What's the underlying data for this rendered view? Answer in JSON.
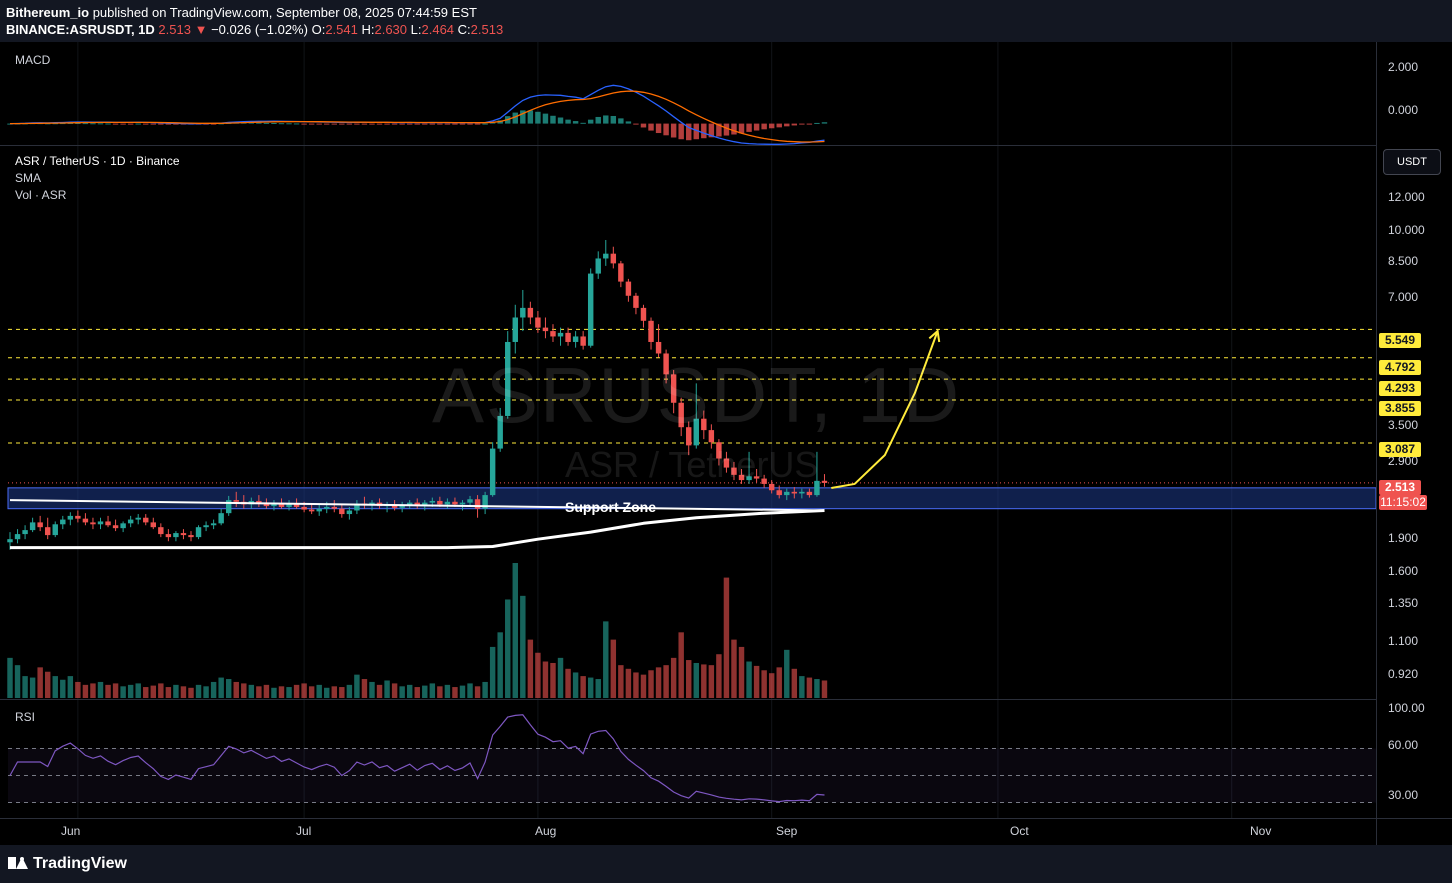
{
  "header": {
    "author": "Bithereum_io",
    "published_text": " published on TradingView.com, September 08, 2025 07:44:59 EST",
    "symbol_line": "BINANCE:ASRUSDT, 1D",
    "last": "2.513",
    "change_arrow": "▼",
    "change": "−0.026 (−1.02%)",
    "o_label": "O:",
    "o_value": "2.541",
    "h_label": "H:",
    "h_value": "2.630",
    "l_label": "L:",
    "l_value": "2.464",
    "c_label": "C:",
    "c_value": "2.513"
  },
  "macd_pane": {
    "label": "MACD",
    "ticks": [
      "2.000",
      "0.000"
    ]
  },
  "price_pane": {
    "title": "ASR / TetherUS · 1D · Binance",
    "sma_label": "SMA",
    "vol_label": "Vol · ASR",
    "currency_button": "USDT",
    "watermark": "ASRUSDT, 1D",
    "watermark_sub": "ASR / TetherUS",
    "support_label": "Support Zone",
    "ticks": [
      "12.000",
      "10.000",
      "8.500",
      "7.000",
      "3.500",
      "2.900",
      "1.900",
      "1.600",
      "1.350",
      "1.100",
      "0.920"
    ],
    "level_badges": [
      "5.549",
      "4.792",
      "4.293",
      "3.855",
      "3.087"
    ],
    "current_price": "2.513",
    "countdown": "11:15:02"
  },
  "rsi_pane": {
    "label": "RSI",
    "ticks": [
      "100.00",
      "60.00",
      "30.00"
    ]
  },
  "x_axis": {
    "labels": [
      "Jun",
      "Jul",
      "Aug",
      "Sep",
      "Oct",
      "Nov"
    ]
  },
  "footer": {
    "brand": "TradingView"
  },
  "colors": {
    "bull": "#26a69a",
    "bear": "#ef5350",
    "level": "#ffeb3b",
    "sma": "#ffffff",
    "macd": "#2962ff",
    "signal": "#ff6d00",
    "rsi": "#7e57c2",
    "zone": "#1e3a8a"
  },
  "chart_data": {
    "type": "candlestick",
    "symbol": "ASRUSDT",
    "interval": "1D",
    "y_scale": "log",
    "ylim": [
      0.82,
      14.0
    ],
    "x_start_date": "2025-05-23",
    "x_end_date": "2025-11-20",
    "support_zone": [
      2.2,
      2.45
    ],
    "resistance_levels": [
      5.549,
      4.792,
      4.293,
      3.855,
      3.087
    ],
    "ohlc": [
      {
        "date": "2025-05-23",
        "o": 1.85,
        "h": 1.95,
        "l": 1.78,
        "c": 1.88
      },
      {
        "date": "2025-05-24",
        "o": 1.88,
        "h": 1.98,
        "l": 1.84,
        "c": 1.93
      },
      {
        "date": "2025-05-25",
        "o": 1.93,
        "h": 2.02,
        "l": 1.88,
        "c": 1.97
      },
      {
        "date": "2025-05-26",
        "o": 1.97,
        "h": 2.1,
        "l": 1.95,
        "c": 2.05
      },
      {
        "date": "2025-05-27",
        "o": 2.05,
        "h": 2.12,
        "l": 1.96,
        "c": 2.0
      },
      {
        "date": "2025-05-28",
        "o": 2.0,
        "h": 2.1,
        "l": 1.88,
        "c": 1.92
      },
      {
        "date": "2025-05-29",
        "o": 1.92,
        "h": 2.06,
        "l": 1.9,
        "c": 2.03
      },
      {
        "date": "2025-05-30",
        "o": 2.03,
        "h": 2.12,
        "l": 1.98,
        "c": 2.08
      },
      {
        "date": "2025-05-31",
        "o": 2.08,
        "h": 2.16,
        "l": 2.02,
        "c": 2.12
      },
      {
        "date": "2025-06-01",
        "o": 2.12,
        "h": 2.18,
        "l": 2.05,
        "c": 2.09
      },
      {
        "date": "2025-06-02",
        "o": 2.09,
        "h": 2.15,
        "l": 2.02,
        "c": 2.05
      },
      {
        "date": "2025-06-03",
        "o": 2.05,
        "h": 2.1,
        "l": 1.98,
        "c": 2.03
      },
      {
        "date": "2025-06-04",
        "o": 2.03,
        "h": 2.1,
        "l": 1.98,
        "c": 2.06
      },
      {
        "date": "2025-06-05",
        "o": 2.06,
        "h": 2.12,
        "l": 2.0,
        "c": 2.02
      },
      {
        "date": "2025-06-06",
        "o": 2.02,
        "h": 2.08,
        "l": 1.96,
        "c": 1.99
      },
      {
        "date": "2025-06-07",
        "o": 1.99,
        "h": 2.06,
        "l": 1.95,
        "c": 2.04
      },
      {
        "date": "2025-06-08",
        "o": 2.04,
        "h": 2.12,
        "l": 2.0,
        "c": 2.08
      },
      {
        "date": "2025-06-09",
        "o": 2.08,
        "h": 2.14,
        "l": 2.03,
        "c": 2.1
      },
      {
        "date": "2025-06-10",
        "o": 2.1,
        "h": 2.14,
        "l": 2.02,
        "c": 2.05
      },
      {
        "date": "2025-06-11",
        "o": 2.05,
        "h": 2.1,
        "l": 1.98,
        "c": 2.0
      },
      {
        "date": "2025-06-12",
        "o": 2.0,
        "h": 2.04,
        "l": 1.9,
        "c": 1.93
      },
      {
        "date": "2025-06-13",
        "o": 1.93,
        "h": 1.98,
        "l": 1.86,
        "c": 1.9
      },
      {
        "date": "2025-06-14",
        "o": 1.9,
        "h": 1.96,
        "l": 1.86,
        "c": 1.94
      },
      {
        "date": "2025-06-15",
        "o": 1.94,
        "h": 1.98,
        "l": 1.88,
        "c": 1.92
      },
      {
        "date": "2025-06-16",
        "o": 1.92,
        "h": 1.96,
        "l": 1.86,
        "c": 1.9
      },
      {
        "date": "2025-06-17",
        "o": 1.9,
        "h": 2.02,
        "l": 1.88,
        "c": 2.0
      },
      {
        "date": "2025-06-18",
        "o": 2.0,
        "h": 2.06,
        "l": 1.96,
        "c": 2.02
      },
      {
        "date": "2025-06-19",
        "o": 2.02,
        "h": 2.08,
        "l": 1.98,
        "c": 2.04
      },
      {
        "date": "2025-06-20",
        "o": 2.04,
        "h": 2.2,
        "l": 2.02,
        "c": 2.15
      },
      {
        "date": "2025-06-21",
        "o": 2.15,
        "h": 2.35,
        "l": 2.12,
        "c": 2.3
      },
      {
        "date": "2025-06-22",
        "o": 2.3,
        "h": 2.4,
        "l": 2.22,
        "c": 2.28
      },
      {
        "date": "2025-06-23",
        "o": 2.28,
        "h": 2.36,
        "l": 2.2,
        "c": 2.25
      },
      {
        "date": "2025-06-24",
        "o": 2.25,
        "h": 2.33,
        "l": 2.2,
        "c": 2.29
      },
      {
        "date": "2025-06-25",
        "o": 2.29,
        "h": 2.36,
        "l": 2.22,
        "c": 2.26
      },
      {
        "date": "2025-06-26",
        "o": 2.26,
        "h": 2.32,
        "l": 2.2,
        "c": 2.23
      },
      {
        "date": "2025-06-27",
        "o": 2.23,
        "h": 2.3,
        "l": 2.18,
        "c": 2.26
      },
      {
        "date": "2025-06-28",
        "o": 2.26,
        "h": 2.32,
        "l": 2.2,
        "c": 2.22
      },
      {
        "date": "2025-06-29",
        "o": 2.22,
        "h": 2.3,
        "l": 2.18,
        "c": 2.25
      },
      {
        "date": "2025-06-30",
        "o": 2.25,
        "h": 2.32,
        "l": 2.2,
        "c": 2.22
      },
      {
        "date": "2025-07-01",
        "o": 2.22,
        "h": 2.28,
        "l": 2.16,
        "c": 2.19
      },
      {
        "date": "2025-07-02",
        "o": 2.19,
        "h": 2.26,
        "l": 2.14,
        "c": 2.17
      },
      {
        "date": "2025-07-03",
        "o": 2.17,
        "h": 2.26,
        "l": 2.12,
        "c": 2.2
      },
      {
        "date": "2025-07-04",
        "o": 2.2,
        "h": 2.28,
        "l": 2.15,
        "c": 2.22
      },
      {
        "date": "2025-07-05",
        "o": 2.22,
        "h": 2.3,
        "l": 2.16,
        "c": 2.2
      },
      {
        "date": "2025-07-06",
        "o": 2.2,
        "h": 2.26,
        "l": 2.1,
        "c": 2.14
      },
      {
        "date": "2025-07-07",
        "o": 2.14,
        "h": 2.22,
        "l": 2.08,
        "c": 2.18
      },
      {
        "date": "2025-07-08",
        "o": 2.18,
        "h": 2.3,
        "l": 2.14,
        "c": 2.26
      },
      {
        "date": "2025-07-09",
        "o": 2.26,
        "h": 2.34,
        "l": 2.2,
        "c": 2.24
      },
      {
        "date": "2025-07-10",
        "o": 2.24,
        "h": 2.3,
        "l": 2.18,
        "c": 2.27
      },
      {
        "date": "2025-07-11",
        "o": 2.27,
        "h": 2.32,
        "l": 2.2,
        "c": 2.23
      },
      {
        "date": "2025-07-12",
        "o": 2.23,
        "h": 2.28,
        "l": 2.16,
        "c": 2.25
      },
      {
        "date": "2025-07-13",
        "o": 2.25,
        "h": 2.3,
        "l": 2.18,
        "c": 2.21
      },
      {
        "date": "2025-07-14",
        "o": 2.21,
        "h": 2.28,
        "l": 2.16,
        "c": 2.24
      },
      {
        "date": "2025-07-15",
        "o": 2.24,
        "h": 2.3,
        "l": 2.2,
        "c": 2.27
      },
      {
        "date": "2025-07-16",
        "o": 2.27,
        "h": 2.32,
        "l": 2.2,
        "c": 2.23
      },
      {
        "date": "2025-07-17",
        "o": 2.23,
        "h": 2.3,
        "l": 2.18,
        "c": 2.27
      },
      {
        "date": "2025-07-18",
        "o": 2.27,
        "h": 2.33,
        "l": 2.22,
        "c": 2.29
      },
      {
        "date": "2025-07-19",
        "o": 2.29,
        "h": 2.34,
        "l": 2.22,
        "c": 2.25
      },
      {
        "date": "2025-07-20",
        "o": 2.25,
        "h": 2.32,
        "l": 2.2,
        "c": 2.28
      },
      {
        "date": "2025-07-21",
        "o": 2.28,
        "h": 2.33,
        "l": 2.22,
        "c": 2.25
      },
      {
        "date": "2025-07-22",
        "o": 2.25,
        "h": 2.3,
        "l": 2.18,
        "c": 2.27
      },
      {
        "date": "2025-07-23",
        "o": 2.27,
        "h": 2.35,
        "l": 2.22,
        "c": 2.31
      },
      {
        "date": "2025-07-24",
        "o": 2.31,
        "h": 2.36,
        "l": 2.1,
        "c": 2.2
      },
      {
        "date": "2025-07-25",
        "o": 2.2,
        "h": 2.4,
        "l": 2.14,
        "c": 2.36
      },
      {
        "date": "2025-07-26",
        "o": 2.36,
        "h": 3.1,
        "l": 2.34,
        "c": 3.0
      },
      {
        "date": "2025-07-27",
        "o": 3.0,
        "h": 3.7,
        "l": 2.95,
        "c": 3.55
      },
      {
        "date": "2025-07-28",
        "o": 3.55,
        "h": 5.5,
        "l": 3.5,
        "c": 5.2
      },
      {
        "date": "2025-07-29",
        "o": 5.2,
        "h": 6.3,
        "l": 4.9,
        "c": 5.9
      },
      {
        "date": "2025-07-30",
        "o": 5.9,
        "h": 6.8,
        "l": 5.5,
        "c": 6.2
      },
      {
        "date": "2025-07-31",
        "o": 6.2,
        "h": 6.4,
        "l": 5.7,
        "c": 5.9
      },
      {
        "date": "2025-08-01",
        "o": 5.9,
        "h": 6.1,
        "l": 5.45,
        "c": 5.6
      },
      {
        "date": "2025-08-02",
        "o": 5.6,
        "h": 5.9,
        "l": 5.3,
        "c": 5.5
      },
      {
        "date": "2025-08-03",
        "o": 5.5,
        "h": 5.7,
        "l": 5.2,
        "c": 5.35
      },
      {
        "date": "2025-08-04",
        "o": 5.35,
        "h": 5.6,
        "l": 5.1,
        "c": 5.45
      },
      {
        "date": "2025-08-05",
        "o": 5.45,
        "h": 5.6,
        "l": 5.1,
        "c": 5.2
      },
      {
        "date": "2025-08-06",
        "o": 5.2,
        "h": 5.5,
        "l": 5.05,
        "c": 5.35
      },
      {
        "date": "2025-08-07",
        "o": 5.35,
        "h": 5.5,
        "l": 5.0,
        "c": 5.1
      },
      {
        "date": "2025-08-08",
        "o": 5.1,
        "h": 7.6,
        "l": 5.05,
        "c": 7.4
      },
      {
        "date": "2025-08-09",
        "o": 7.4,
        "h": 8.3,
        "l": 7.2,
        "c": 8.0
      },
      {
        "date": "2025-08-10",
        "o": 8.0,
        "h": 8.8,
        "l": 7.7,
        "c": 8.2
      },
      {
        "date": "2025-08-11",
        "o": 8.2,
        "h": 8.5,
        "l": 7.6,
        "c": 7.8
      },
      {
        "date": "2025-08-12",
        "o": 7.8,
        "h": 7.9,
        "l": 6.9,
        "c": 7.1
      },
      {
        "date": "2025-08-13",
        "o": 7.1,
        "h": 7.2,
        "l": 6.4,
        "c": 6.6
      },
      {
        "date": "2025-08-14",
        "o": 6.6,
        "h": 6.7,
        "l": 6.0,
        "c": 6.2
      },
      {
        "date": "2025-08-15",
        "o": 6.2,
        "h": 6.3,
        "l": 5.6,
        "c": 5.8
      },
      {
        "date": "2025-08-16",
        "o": 5.8,
        "h": 5.9,
        "l": 5.0,
        "c": 5.2
      },
      {
        "date": "2025-08-17",
        "o": 5.2,
        "h": 5.7,
        "l": 4.8,
        "c": 4.9
      },
      {
        "date": "2025-08-18",
        "o": 4.9,
        "h": 5.0,
        "l": 4.2,
        "c": 4.4
      },
      {
        "date": "2025-08-19",
        "o": 4.4,
        "h": 4.5,
        "l": 3.6,
        "c": 3.8
      },
      {
        "date": "2025-08-20",
        "o": 3.8,
        "h": 3.9,
        "l": 3.2,
        "c": 3.35
      },
      {
        "date": "2025-08-21",
        "o": 3.35,
        "h": 3.45,
        "l": 2.9,
        "c": 3.05
      },
      {
        "date": "2025-08-22",
        "o": 3.05,
        "h": 4.2,
        "l": 3.0,
        "c": 3.5
      },
      {
        "date": "2025-08-23",
        "o": 3.5,
        "h": 3.65,
        "l": 3.15,
        "c": 3.3
      },
      {
        "date": "2025-08-24",
        "o": 3.3,
        "h": 3.4,
        "l": 3.0,
        "c": 3.1
      },
      {
        "date": "2025-08-25",
        "o": 3.1,
        "h": 3.15,
        "l": 2.75,
        "c": 2.85
      },
      {
        "date": "2025-08-26",
        "o": 2.85,
        "h": 2.95,
        "l": 2.65,
        "c": 2.72
      },
      {
        "date": "2025-08-27",
        "o": 2.72,
        "h": 2.8,
        "l": 2.55,
        "c": 2.62
      },
      {
        "date": "2025-08-28",
        "o": 2.62,
        "h": 2.7,
        "l": 2.5,
        "c": 2.55
      },
      {
        "date": "2025-08-29",
        "o": 2.55,
        "h": 2.95,
        "l": 2.5,
        "c": 2.6
      },
      {
        "date": "2025-08-30",
        "o": 2.6,
        "h": 2.7,
        "l": 2.52,
        "c": 2.57
      },
      {
        "date": "2025-08-31",
        "o": 2.57,
        "h": 2.62,
        "l": 2.45,
        "c": 2.5
      },
      {
        "date": "2025-09-01",
        "o": 2.5,
        "h": 2.55,
        "l": 2.38,
        "c": 2.42
      },
      {
        "date": "2025-09-02",
        "o": 2.42,
        "h": 2.48,
        "l": 2.32,
        "c": 2.36
      },
      {
        "date": "2025-09-03",
        "o": 2.36,
        "h": 2.44,
        "l": 2.3,
        "c": 2.4
      },
      {
        "date": "2025-09-04",
        "o": 2.4,
        "h": 2.46,
        "l": 2.32,
        "c": 2.38
      },
      {
        "date": "2025-09-05",
        "o": 2.38,
        "h": 2.44,
        "l": 2.32,
        "c": 2.4
      },
      {
        "date": "2025-09-06",
        "o": 2.4,
        "h": 2.44,
        "l": 2.33,
        "c": 2.36
      },
      {
        "date": "2025-09-07",
        "o": 2.36,
        "h": 2.95,
        "l": 2.34,
        "c": 2.54
      },
      {
        "date": "2025-09-08",
        "o": 2.541,
        "h": 2.63,
        "l": 2.464,
        "c": 2.513
      }
    ],
    "volume": [
      0.55,
      0.45,
      0.3,
      0.28,
      0.42,
      0.36,
      0.3,
      0.25,
      0.3,
      0.22,
      0.18,
      0.2,
      0.22,
      0.18,
      0.2,
      0.16,
      0.18,
      0.2,
      0.15,
      0.17,
      0.2,
      0.15,
      0.18,
      0.16,
      0.14,
      0.18,
      0.16,
      0.22,
      0.28,
      0.26,
      0.22,
      0.2,
      0.18,
      0.16,
      0.18,
      0.14,
      0.16,
      0.15,
      0.18,
      0.2,
      0.16,
      0.18,
      0.14,
      0.16,
      0.15,
      0.18,
      0.32,
      0.26,
      0.22,
      0.18,
      0.24,
      0.2,
      0.16,
      0.18,
      0.15,
      0.17,
      0.2,
      0.16,
      0.18,
      0.15,
      0.17,
      0.2,
      0.16,
      0.22,
      0.7,
      0.9,
      1.35,
      1.85,
      1.4,
      0.8,
      0.62,
      0.5,
      0.48,
      0.55,
      0.4,
      0.35,
      0.3,
      0.28,
      0.26,
      1.05,
      0.8,
      0.45,
      0.4,
      0.35,
      0.32,
      0.38,
      0.42,
      0.45,
      0.55,
      0.9,
      0.52,
      0.48,
      0.46,
      0.45,
      0.6,
      1.65,
      0.8,
      0.7,
      0.5,
      0.44,
      0.38,
      0.34,
      0.42,
      0.66,
      0.4,
      0.3,
      0.28,
      0.26,
      0.24,
      0.24,
      0.22,
      0.28,
      0.35,
      1.1,
      0.3
    ],
    "sma": [
      {
        "date": "2025-05-23",
        "v": 1.8
      },
      {
        "date": "2025-06-15",
        "v": 1.8
      },
      {
        "date": "2025-07-20",
        "v": 1.8
      },
      {
        "date": "2025-07-26",
        "v": 1.81
      },
      {
        "date": "2025-08-01",
        "v": 1.88
      },
      {
        "date": "2025-08-08",
        "v": 1.95
      },
      {
        "date": "2025-08-15",
        "v": 2.04
      },
      {
        "date": "2025-08-22",
        "v": 2.1
      },
      {
        "date": "2025-08-31",
        "v": 2.15
      },
      {
        "date": "2025-09-08",
        "v": 2.18
      }
    ],
    "projection_path": [
      {
        "date": "2025-09-09",
        "v": 2.45
      },
      {
        "date": "2025-09-12",
        "v": 2.5
      },
      {
        "date": "2025-09-16",
        "v": 2.9
      },
      {
        "date": "2025-09-20",
        "v": 4.0
      },
      {
        "date": "2025-09-23",
        "v": 5.5
      }
    ],
    "macd": {
      "ylim": [
        -0.6,
        2.4
      ]
    },
    "rsi": {
      "ylim": [
        20,
        100
      ],
      "levels": [
        70,
        50,
        30
      ]
    }
  }
}
